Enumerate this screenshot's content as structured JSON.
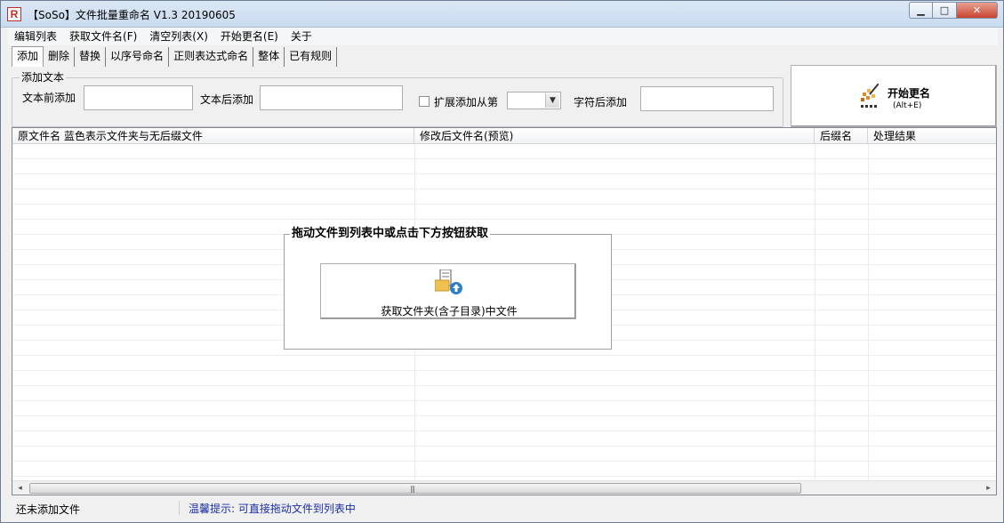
{
  "window": {
    "title": "【SoSo】文件批量重命名   V1.3 20190605",
    "app_icon_letter": "R",
    "controls": {
      "minimize": "▁",
      "maximize": "□",
      "close": "✕"
    }
  },
  "menu": {
    "items": [
      {
        "label": "编辑列表"
      },
      {
        "label": "获取文件名(F)"
      },
      {
        "label": "清空列表(X)"
      },
      {
        "label": "开始更名(E)"
      },
      {
        "label": "关于"
      }
    ]
  },
  "tabs": {
    "active_index": 0,
    "items": [
      {
        "label": "添加"
      },
      {
        "label": "删除"
      },
      {
        "label": "替换"
      },
      {
        "label": "以序号命名"
      },
      {
        "label": "正则表达式命名"
      },
      {
        "label": "整体"
      },
      {
        "label": "已有规则"
      }
    ]
  },
  "add_text_group": {
    "legend": "添加文本",
    "prefix_label": "文本前添加",
    "prefix_value": "",
    "suffix_label": "文本后添加",
    "suffix_value": "",
    "extend_label": "扩展添加从第",
    "extend_checked": false,
    "extend_index": "",
    "char_after_label": "字符后添加",
    "char_after_value": ""
  },
  "start_button": {
    "label": "开始更名",
    "shortcut": "(Alt+E)",
    "icon": "rename-wand-icon"
  },
  "list": {
    "columns": [
      {
        "label": "原文件名  蓝色表示文件夹与无后缀文件"
      },
      {
        "label": "修改后文件名(预览)"
      },
      {
        "label": "后缀名"
      },
      {
        "label": "处理结果"
      }
    ],
    "rows": []
  },
  "drop_area": {
    "legend": "拖动文件到列表中或点击下方按钮获取",
    "button_label": "获取文件夹(含子目录)中文件",
    "icon": "folder-upload-icon"
  },
  "status": {
    "left": "还未添加文件",
    "tip": "温馨提示: 可直接拖动文件到列表中"
  },
  "scrollbar": {
    "left_arrow": "◂",
    "right_arrow": "▸",
    "grip": "|||"
  },
  "combo_arrow": "▼",
  "colors": {
    "tip_text": "#1a2ea8",
    "close_button": "#c8442e",
    "icon_orange": "#e08a2a"
  }
}
